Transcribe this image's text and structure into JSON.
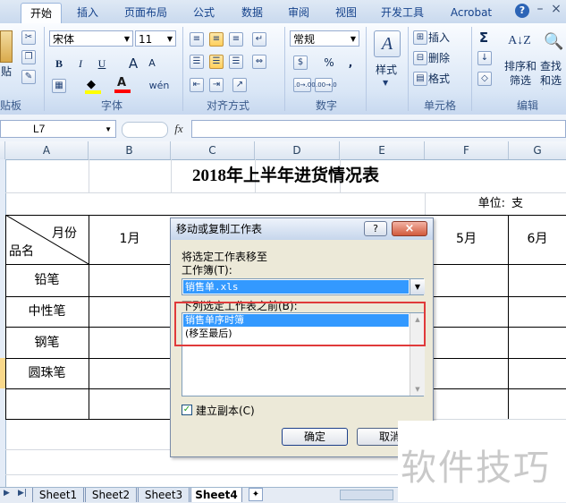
{
  "ribbon_tabs": [
    {
      "label": "开始",
      "active": true
    },
    {
      "label": "插入",
      "active": false
    },
    {
      "label": "页面布局",
      "active": false
    },
    {
      "label": "公式",
      "active": false
    },
    {
      "label": "数据",
      "active": false
    },
    {
      "label": "审阅",
      "active": false
    },
    {
      "label": "视图",
      "active": false
    },
    {
      "label": "开发工具",
      "active": false
    },
    {
      "label": "Acrobat",
      "active": false
    }
  ],
  "window_controls": {
    "help": "?",
    "minimize": "–",
    "close": "×"
  },
  "groups": {
    "clipboard": {
      "paste_label": "贴",
      "label": "贴板"
    },
    "font": {
      "font_name": "宋体",
      "font_size": "11",
      "bold": "B",
      "italic": "I",
      "underline": "U",
      "grow": "A",
      "shrink": "A",
      "wen": "wén",
      "label": "字体"
    },
    "alignment": {
      "label": "对齐方式"
    },
    "number": {
      "format": "常规",
      "percent": "%",
      "comma": ",",
      "inc_decimal": ".0→.00",
      "dec_decimal": ".00→.0",
      "label": "数字"
    },
    "styles": {
      "label": "样式"
    },
    "cells": {
      "insert": "插入",
      "delete": "删除",
      "format": "格式",
      "label": "单元格"
    },
    "editing": {
      "sigma": "Σ",
      "sort_filter": "排序和筛选",
      "find_select": "查找和选择",
      "label": "编辑"
    }
  },
  "formula_bar": {
    "name_box": "L7",
    "fx": "fx"
  },
  "columns": [
    "A",
    "B",
    "C",
    "D",
    "E",
    "F",
    "G"
  ],
  "sheet": {
    "title": "2018年上半年进货情况表",
    "unit_label": "单位:",
    "unit_value": "支",
    "corner_top": "月份",
    "corner_bottom": "品名",
    "month_headers": [
      "1月",
      "5月",
      "6月"
    ],
    "items": [
      "铅笔",
      "中性笔",
      "钢笔",
      "圆珠笔"
    ]
  },
  "dialog": {
    "title": "移动或复制工作表",
    "help": "?",
    "close": "×",
    "move_to_label": "将选定工作表移至",
    "workbook_label": "工作簿(T):",
    "workbook_value": "销售单.xls",
    "before_label": "下列选定工作表之前(B):",
    "sheets": [
      "销售单序时簿",
      "(移至最后)"
    ],
    "selected_index": 0,
    "copy_checkbox_label": "建立副本(C)",
    "copy_checked": true,
    "ok_label": "确定",
    "cancel_label": "取消"
  },
  "sheet_tabs": [
    "Sheet1",
    "Sheet2",
    "Sheet3",
    "Sheet4"
  ],
  "active_sheet_tab": "Sheet4",
  "watermark": "软件技巧",
  "colors": {
    "accent": "#3399ff",
    "highlight_box": "#e03a3a",
    "ribbon_text": "#15428b"
  }
}
